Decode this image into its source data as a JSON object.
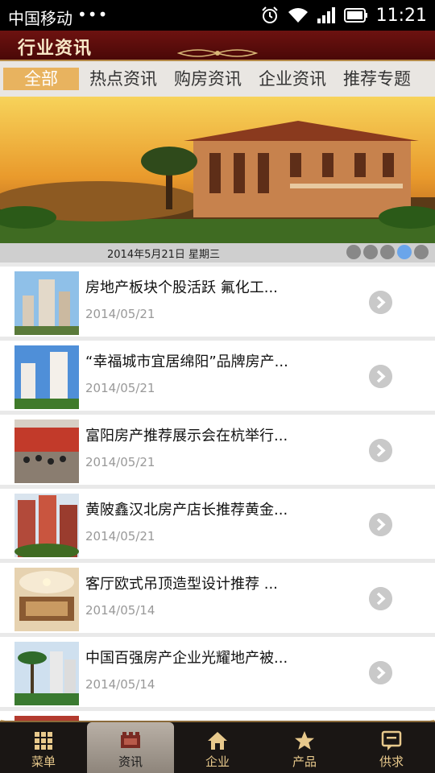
{
  "status_bar": {
    "carrier": "中国移动",
    "dots": "•••",
    "time": "11:21"
  },
  "header": {
    "title": "行业资讯"
  },
  "tabs": [
    {
      "label": "全部",
      "active": true
    },
    {
      "label": "热点资讯",
      "active": false
    },
    {
      "label": "购房资讯",
      "active": false
    },
    {
      "label": "企业资讯",
      "active": false
    },
    {
      "label": "推荐专题",
      "active": false
    }
  ],
  "banner": {
    "date_text": "2014年5月21日  星期三",
    "pager_count": 5,
    "pager_active_index": 3
  },
  "news": [
    {
      "title": "房地产板块个股活跃 氟化工...",
      "date": "2014/05/21",
      "thumb": "towers-thumb"
    },
    {
      "title": "“幸福城市宜居绵阳”品牌房产...",
      "date": "2014/05/21",
      "thumb": "towers-thumb"
    },
    {
      "title": "富阳房产推荐展示会在杭举行...",
      "date": "2014/05/21",
      "thumb": "crowd-thumb"
    },
    {
      "title": "黄陂鑫汉北房产店长推荐黄金...",
      "date": "2014/05/21",
      "thumb": "apartments-thumb"
    },
    {
      "title": "客厅欧式吊顶造型设计推荐 ...",
      "date": "2014/05/14",
      "thumb": "interior-thumb"
    },
    {
      "title": "中国百强房产企业光耀地产被...",
      "date": "2014/05/14",
      "thumb": "palm-towers-thumb"
    }
  ],
  "bottom_nav": [
    {
      "label": "菜单",
      "icon": "grid-icon",
      "active": false
    },
    {
      "label": "资讯",
      "icon": "film-icon",
      "active": true
    },
    {
      "label": "企业",
      "icon": "home-icon",
      "active": false
    },
    {
      "label": "产品",
      "icon": "star-icon",
      "active": false
    },
    {
      "label": "供求",
      "icon": "chat-icon",
      "active": false
    }
  ],
  "colors": {
    "header_bg": "#5e0e0c",
    "tab_active": "#e8b35f",
    "pager_active": "#6aa5ea",
    "nav_text": "#e8c98c"
  }
}
